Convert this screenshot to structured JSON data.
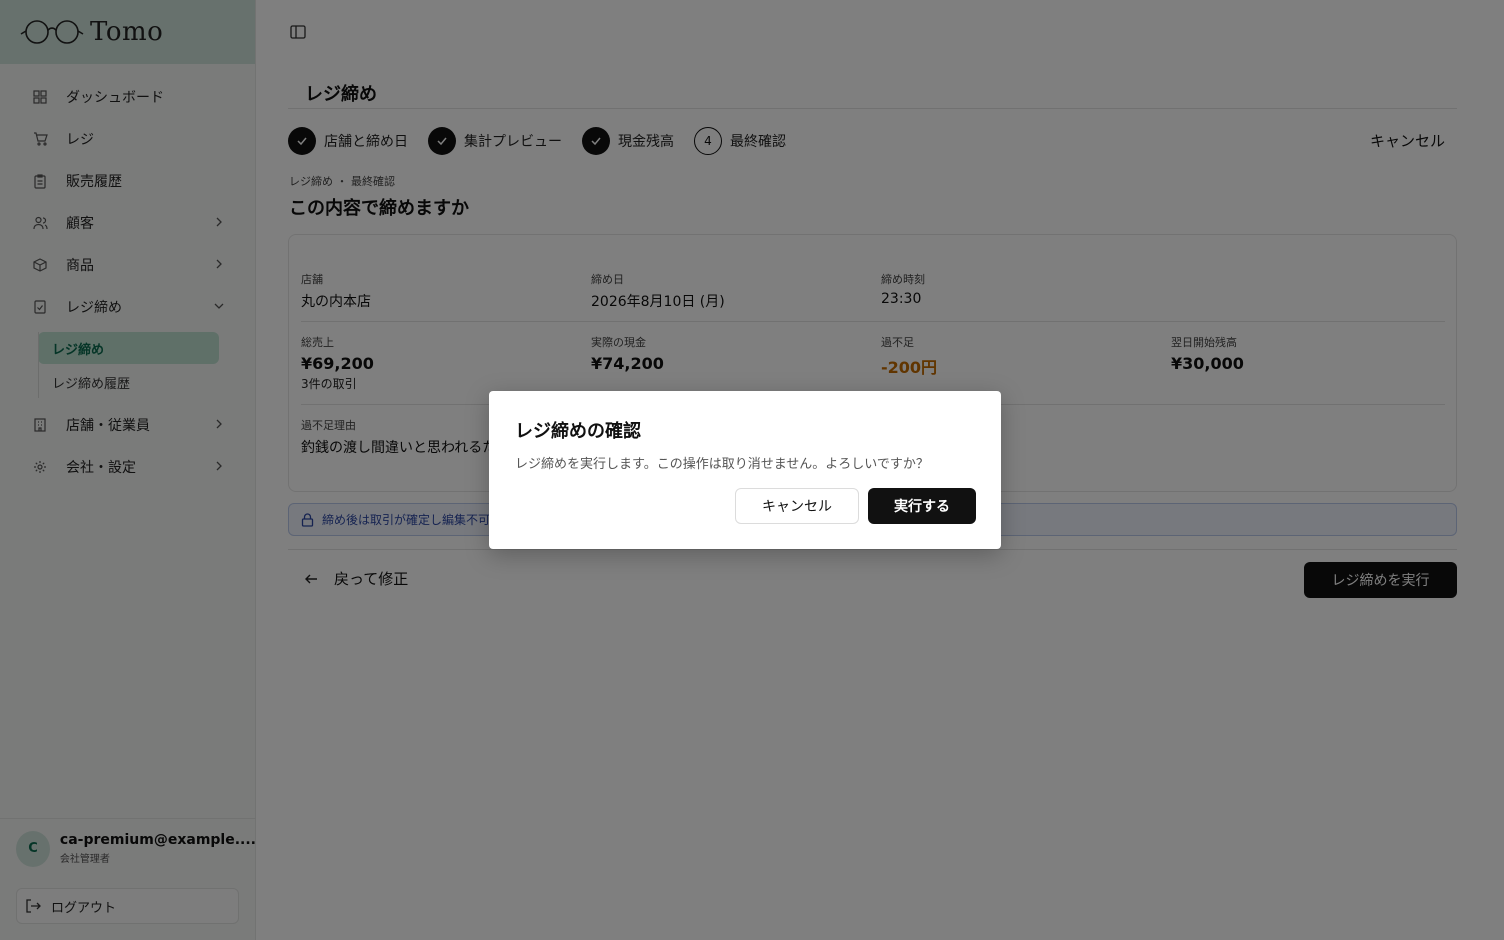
{
  "app": {
    "logo_text": "Tomo"
  },
  "sidebar": {
    "items": [
      {
        "label": "ダッシュボード",
        "icon": "grid-icon"
      },
      {
        "label": "レジ",
        "icon": "cart-icon"
      },
      {
        "label": "販売履歴",
        "icon": "clipboard-icon"
      },
      {
        "label": "顧客",
        "icon": "users-icon",
        "chevron": "chevron-right-icon"
      },
      {
        "label": "商品",
        "icon": "package-icon",
        "chevron": "chevron-right-icon"
      },
      {
        "label": "レジ締め",
        "icon": "register-close-icon",
        "chevron": "chevron-down-icon"
      },
      {
        "label": "店舗・従業員",
        "icon": "building-icon",
        "chevron": "chevron-right-icon"
      },
      {
        "label": "会社・設定",
        "icon": "gear-icon",
        "chevron": "chevron-right-icon"
      }
    ],
    "sub_items": [
      {
        "label": "レジ締め",
        "active": true
      },
      {
        "label": "レジ締め履歴",
        "active": false
      }
    ],
    "user": {
      "initial": "C",
      "email": "ca-premium@example....",
      "role": "会社管理者"
    },
    "logout_label": "ログアウト"
  },
  "page": {
    "title": "レジ締め",
    "cancel_label": "キャンセル",
    "steps": [
      {
        "label": "店舗と締め日",
        "state": "done"
      },
      {
        "label": "集計プレビュー",
        "state": "done"
      },
      {
        "label": "現金残高",
        "state": "done"
      },
      {
        "label": "最終確認",
        "state": "current",
        "number": "4"
      }
    ],
    "breadcrumb": "レジ締め ・ 最終確認",
    "heading": "この内容で締めますか",
    "summary": {
      "store_label": "店舗",
      "store_value": "丸の内本店",
      "date_label": "締め日",
      "date_value": "2026年8月10日 (月)",
      "time_label": "締め時刻",
      "time_value": "23:30",
      "sales_label": "総売上",
      "sales_value": "¥69,200",
      "sales_sub": "3件の取引",
      "cash_label": "実際の現金",
      "cash_value": "¥74,200",
      "diff_label": "過不足",
      "diff_value": "-200円",
      "next_label": "翌日開始残高",
      "next_value": "¥30,000",
      "reason_label": "過不足理由",
      "reason_value": "釣銭の渡し間違いと思われるた"
    },
    "lock_notice": "締め後は取引が確定し編集不可",
    "back_label": "戻って修正",
    "execute_label": "レジ締めを実行"
  },
  "modal": {
    "title": "レジ締めの確認",
    "description": "レジ締めを実行します。この操作は取り消せません。よろしいですか？",
    "cancel_label": "キャンセル",
    "confirm_label": "実行する"
  },
  "colors": {
    "accent": "#0b6b4e",
    "logo_bg": "#cfe3da",
    "warning": "#c26a00",
    "notice": "#2c47a3"
  }
}
